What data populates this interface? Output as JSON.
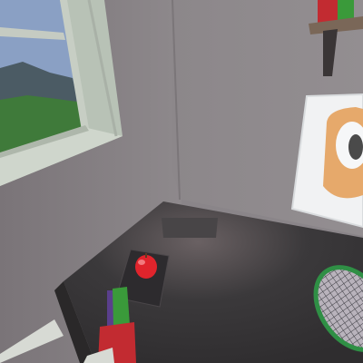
{
  "scene": {
    "name": "vr-room-corner-view",
    "colors": {
      "wall_left": "#7f7a7d",
      "wall_right": "#8e898c",
      "ceiling": "#908b8e",
      "desk_top": "#39373a",
      "desk_edge": "#2a2829",
      "window_frame": "#b7c0b3",
      "sky": "#8aa0c4",
      "grass": "#3f7a3a",
      "hills": "#4b5b64",
      "poster_bg": "#e9ecef",
      "poster_accent": "#e6a96b",
      "apple": "#e0242c",
      "racket_frame": "#2f8f45",
      "books_green": "#3a9a3a",
      "books_red": "#c22b31",
      "books_purple": "#6a3f8a",
      "shelf": "#5b4a3e"
    },
    "objects": [
      "window",
      "shelf",
      "poster",
      "desk",
      "apple",
      "tablet",
      "racket",
      "books",
      "screen-panel"
    ]
  }
}
